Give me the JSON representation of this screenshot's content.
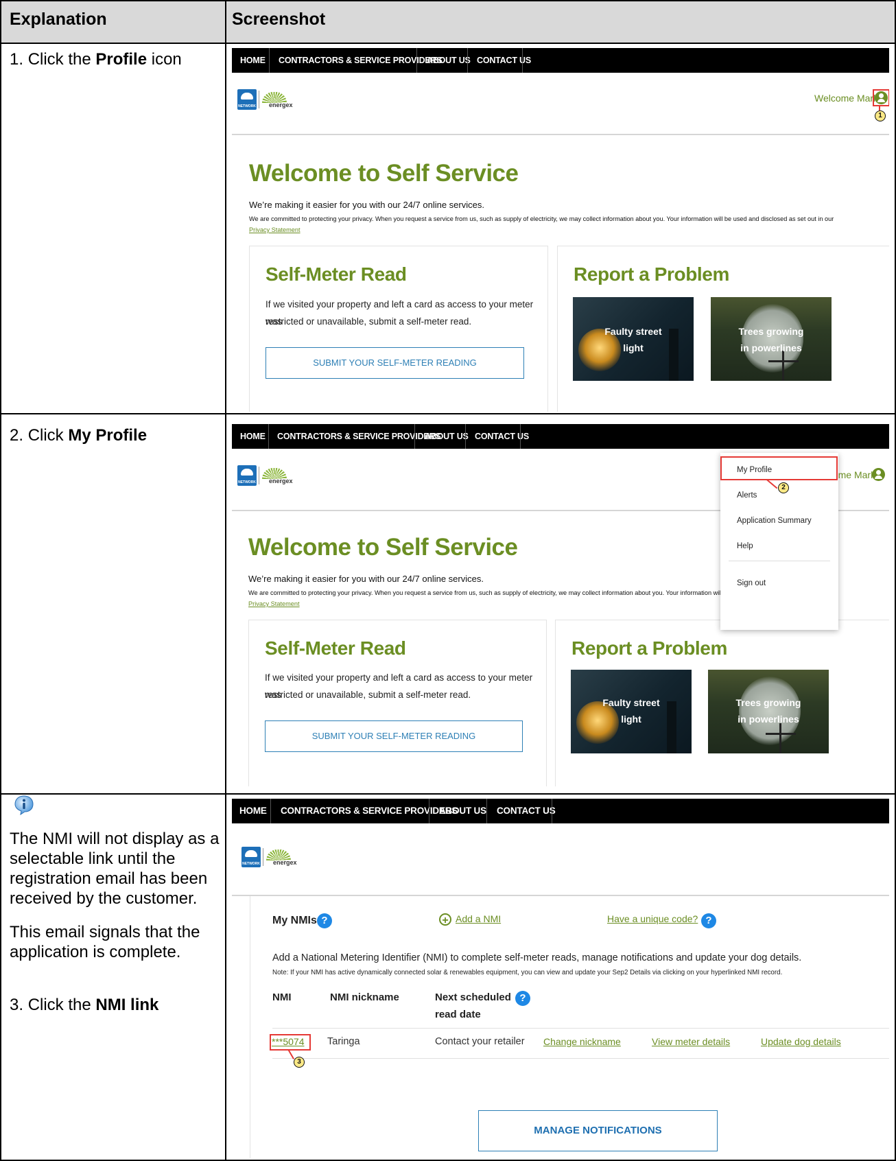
{
  "header": {
    "col1": "Explanation",
    "col2": "Screenshot"
  },
  "rows": [
    {
      "step_number": "1.",
      "text_before": "Click the ",
      "bold": "Profile",
      "text_after": " icon"
    },
    {
      "step_number": "2.",
      "text_before": "Click ",
      "bold": "My Profile",
      "text_after": ""
    },
    {
      "step_number": "3.",
      "text_before": "Click the ",
      "bold": "NMI link",
      "text_after": ""
    }
  ],
  "note": {
    "icon": "info-icon",
    "paragraph1": "The NMI will not display as a selectable link until the registration email has been received by the customer.",
    "paragraph2": "This email signals that the application is complete."
  },
  "site": {
    "nav": [
      "HOME",
      "CONTRACTORS & SERVICE PROVIDERS",
      "ABOUT US",
      "CONTACT US"
    ],
    "logo": {
      "ergon_text": "NETWORK",
      "energex_text": "energex"
    },
    "welcome_user": "Welcome Mark",
    "page_title": "Welcome to Self Service",
    "intro": "We’re making it easier for you with our 24/7 online services.",
    "privacy_text": "We are committed to protecting your privacy. When you request a service from us, such as supply of electricity, we may collect information about you. Your information will be used and disclosed as set out in our",
    "privacy_text_truncated": "We are committed to protecting your privacy. When you request a service from us, such as supply of electricity, we may collect information about you. Your information will b",
    "privacy_link": "Privacy Statement",
    "self_meter": {
      "title": "Self-Meter Read",
      "line1": "If we visited your property and left a card as access to your meter was",
      "line2": "restricted or unavailable, submit a self-meter read.",
      "button": "SUBMIT YOUR SELF-METER READING"
    },
    "report": {
      "title": "Report a Problem",
      "tile1_line1": "Faulty street",
      "tile1_line2": "light",
      "tile2_line1": "Trees growing",
      "tile2_line2": "in powerlines"
    },
    "profile_menu": [
      "My Profile",
      "Alerts",
      "Application Summary",
      "Help",
      "Sign out"
    ],
    "nmis": {
      "title": "My NMIs",
      "add_link": "Add a NMI",
      "unique_code_link": "Have a unique code?",
      "description": "Add a National Metering Identifier (NMI) to complete self-meter reads, manage notifications and update your dog details.",
      "note": "Note: If your NMI has active dynamically connected solar & renewables equipment, you can view and update your Sep2 Details via clicking on your hyperlinked NMI record.",
      "columns": [
        "NMI",
        "NMI nickname",
        "Next scheduled",
        "read date"
      ],
      "row": {
        "nmi": "***5074",
        "nickname": "Taringa",
        "next_read": "Contact your retailer",
        "action1": "Change nickname",
        "action2": "View meter details",
        "action3": "Update dog details"
      },
      "manage_button": "MANAGE NOTIFICATIONS"
    }
  },
  "annotations": {
    "step1": "1",
    "step2": "2",
    "step3": "3"
  },
  "colors": {
    "brand_green": "#6b8e23",
    "accent_blue": "#2d7fb5",
    "highlight_red": "#e53935",
    "header_gray": "#d9d9d9"
  }
}
